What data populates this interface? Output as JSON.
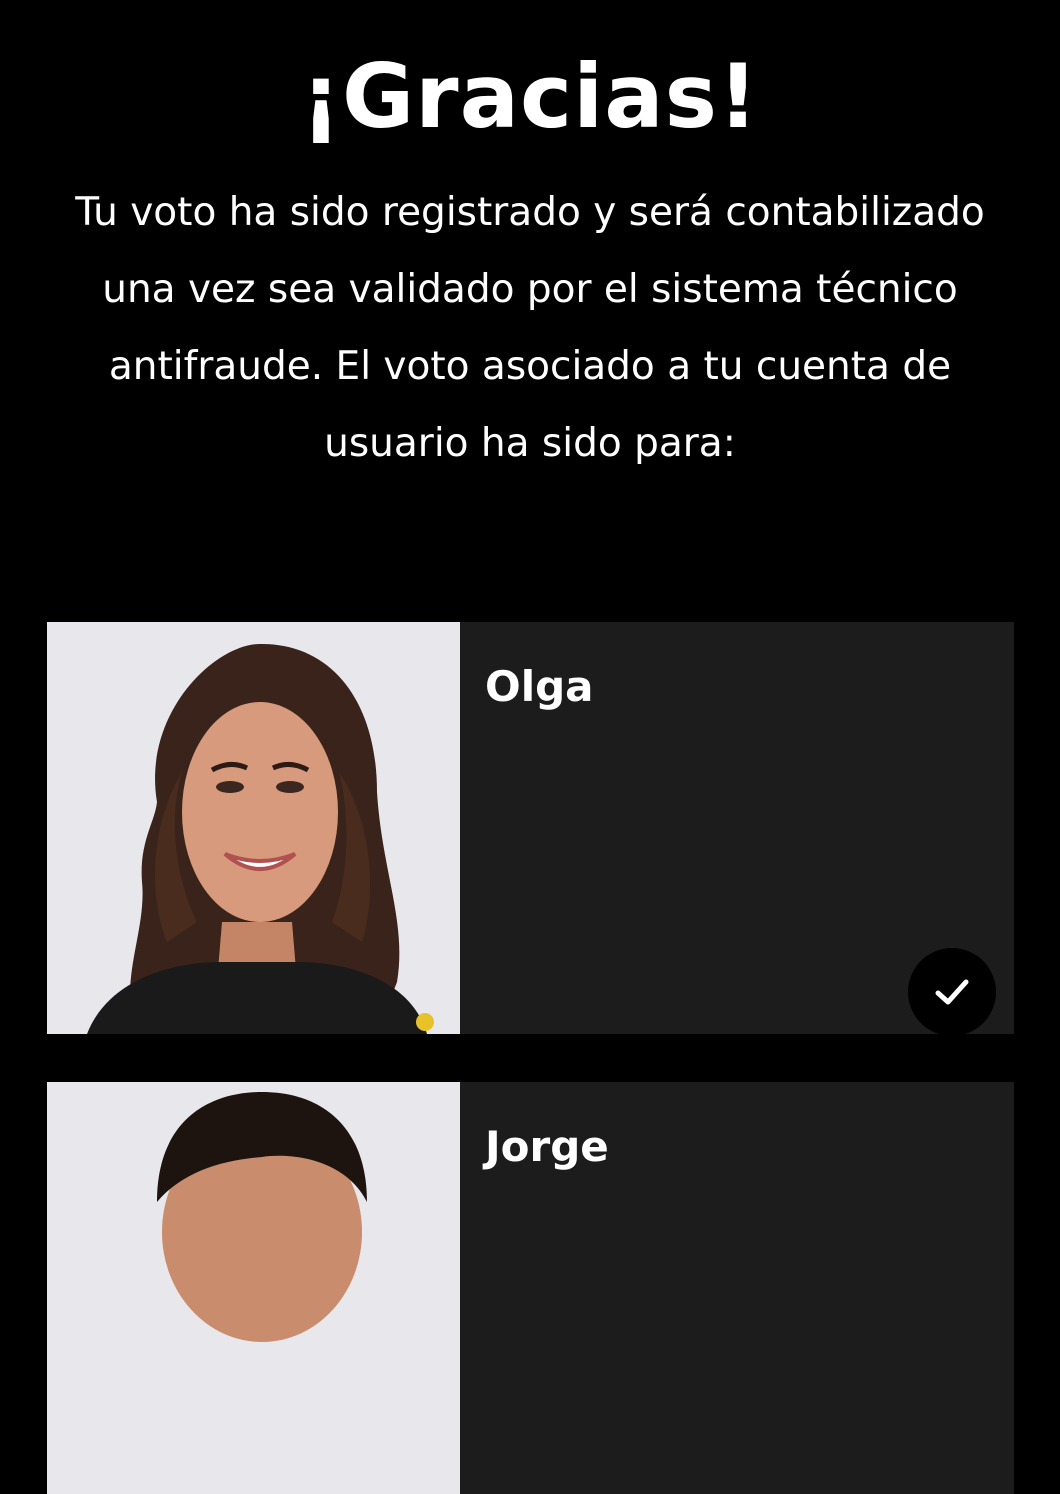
{
  "header": {
    "title": "¡Gracias!",
    "message": "Tu voto ha sido registrado y será contabilizado una vez sea validado por el sistema técnico antifraude. El voto asociado a tu cuenta de usuario ha sido para:"
  },
  "candidates": [
    {
      "name": "Olga",
      "selected": true,
      "icon": "check-icon"
    },
    {
      "name": "Jorge",
      "selected": false
    }
  ],
  "colors": {
    "background": "#000000",
    "card": "#1c1c1c",
    "text": "#ffffff",
    "photo_background": "#e7e7ec"
  }
}
